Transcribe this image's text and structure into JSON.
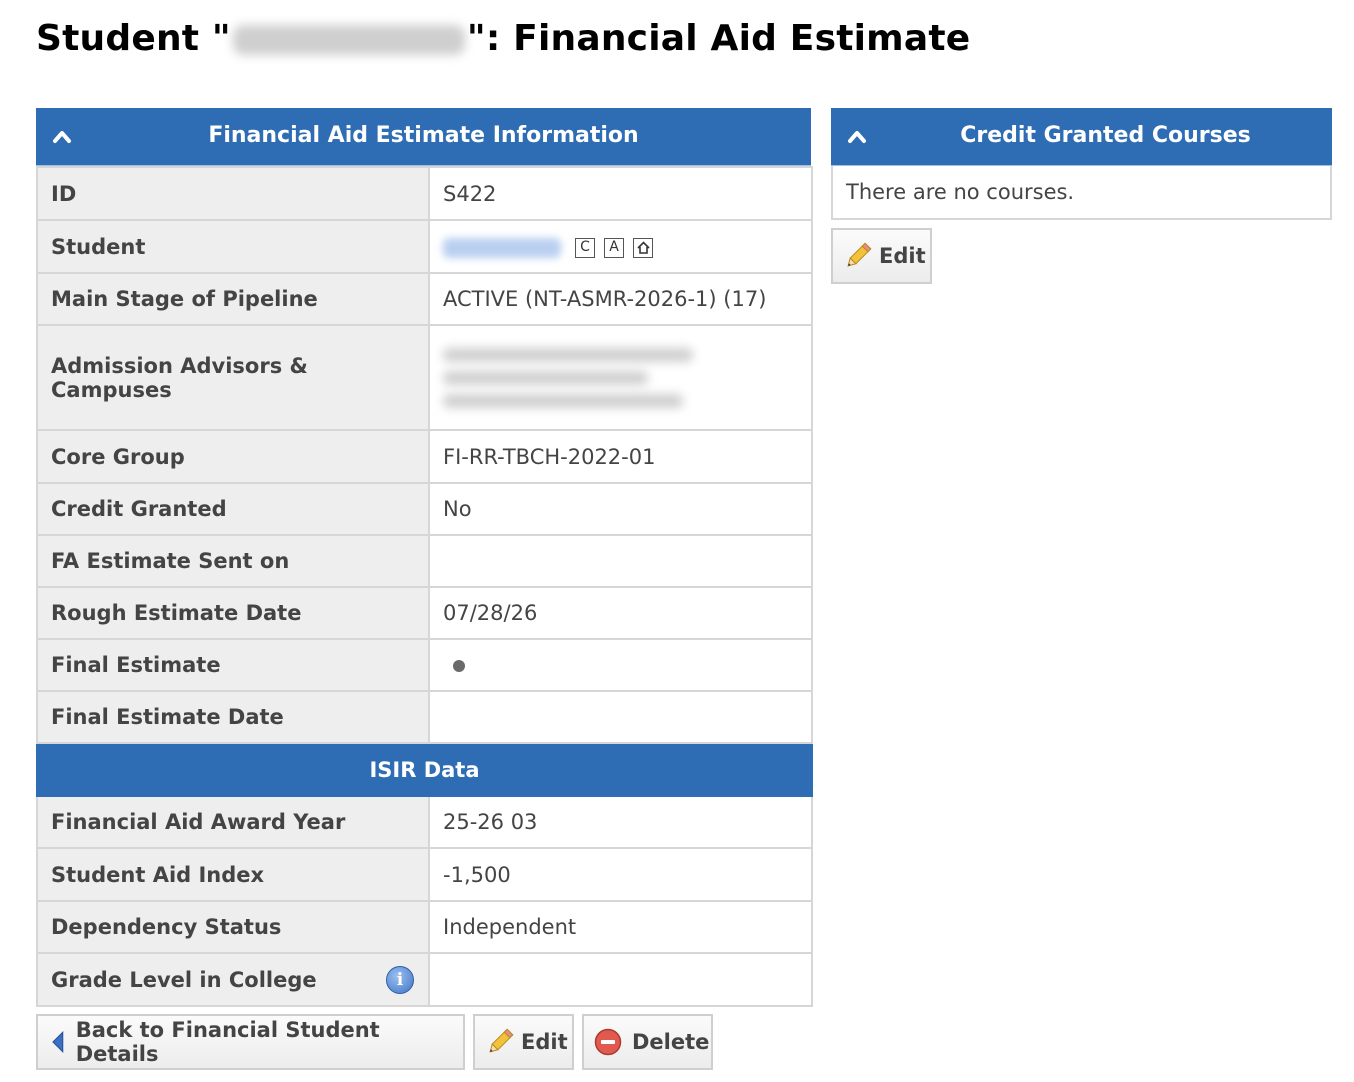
{
  "page": {
    "title_prefix": "Student \"",
    "title_suffix": "\": Financial Aid Estimate"
  },
  "estimate_panel": {
    "header": "Financial Aid Estimate Information",
    "rows": {
      "id": {
        "label": "ID",
        "value": "S422"
      },
      "student": {
        "label": "Student",
        "icon_c": "C",
        "icon_a": "A"
      },
      "main_stage": {
        "label": "Main Stage of Pipeline",
        "value": "ACTIVE (NT-ASMR-2026-1) (17)"
      },
      "advisors": {
        "label": "Admission Advisors & Campuses"
      },
      "core_group": {
        "label": "Core Group",
        "value": "FI-RR-TBCH-2022-01"
      },
      "credit_granted": {
        "label": "Credit Granted",
        "value": "No"
      },
      "fa_sent": {
        "label": "FA Estimate Sent on",
        "value": ""
      },
      "rough_date": {
        "label": "Rough Estimate Date",
        "value": "07/28/26"
      },
      "final_estimate": {
        "label": "Final Estimate"
      },
      "final_date": {
        "label": "Final Estimate Date",
        "value": ""
      }
    },
    "isir_header": "ISIR Data",
    "isir_rows": {
      "award_year": {
        "label": "Financial Aid Award Year",
        "value": "25-26 03"
      },
      "aid_index": {
        "label": "Student Aid Index",
        "value": "-1,500"
      },
      "dependency": {
        "label": "Dependency Status",
        "value": "Independent"
      },
      "grade_level": {
        "label": "Grade Level in College",
        "value": "",
        "info_icon": "i"
      }
    }
  },
  "credit_panel": {
    "header": "Credit Granted Courses",
    "empty_text": "There are no courses.",
    "edit_label": "Edit"
  },
  "actions": {
    "back_label": "Back to Financial Student Details",
    "edit_label": "Edit",
    "delete_label": "Delete"
  },
  "colors": {
    "header_blue": "#2e6db4",
    "link_blue": "#2461a8",
    "label_bg": "#eeeeee"
  }
}
